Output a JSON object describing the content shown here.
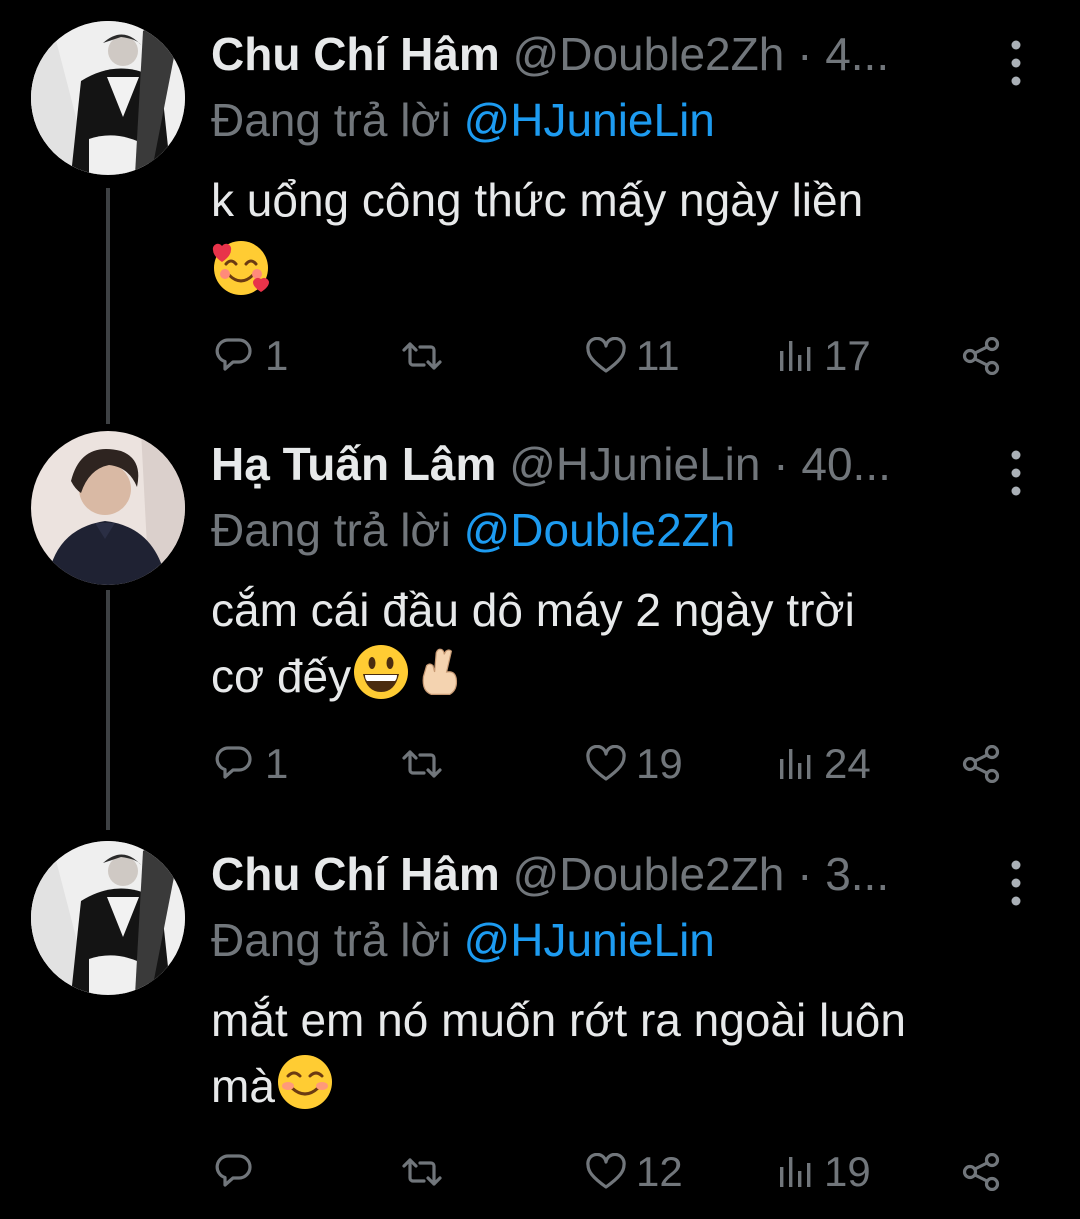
{
  "colors": {
    "background": "#000000",
    "text": "#e7e9ea",
    "muted": "#71767b",
    "link": "#1d9bf0",
    "thread_line": "#3e4144"
  },
  "tweets": [
    {
      "name": "Chu Chí Hâm",
      "handle": "@Double2Zh",
      "separator": "·",
      "time": "4...",
      "reply_prefix": "Đang trả lời",
      "reply_to": "@HJunieLin",
      "text": "k uổng công thức mấy ngày liền",
      "emojis": [
        "smiling-face-with-hearts"
      ],
      "replies": "1",
      "retweets": "",
      "likes": "11",
      "views": "17"
    },
    {
      "name": "Hạ Tuấn Lâm",
      "handle": "@HJunieLin",
      "separator": "·",
      "time": "40...",
      "reply_prefix": "Đang trả lời",
      "reply_to": "@Double2Zh",
      "text_line1": "cắm cái đầu dô máy 2 ngày trời",
      "text_line2": "cơ đếy",
      "emojis": [
        "grinning-face",
        "crossed-fingers"
      ],
      "replies": "1",
      "retweets": "",
      "likes": "19",
      "views": "24"
    },
    {
      "name": "Chu Chí Hâm",
      "handle": "@Double2Zh",
      "separator": "·",
      "time": "3...",
      "reply_prefix": "Đang trả lời",
      "reply_to": "@HJunieLin",
      "text_line1": "mắt em nó muốn rớt ra ngoài luôn",
      "text_line2": "mà",
      "emojis": [
        "smiling-face"
      ],
      "replies": "",
      "retweets": "",
      "likes": "12",
      "views": "19"
    }
  ],
  "icons": [
    "reply-icon",
    "retweet-icon",
    "like-icon",
    "views-icon",
    "share-icon",
    "more-icon"
  ]
}
